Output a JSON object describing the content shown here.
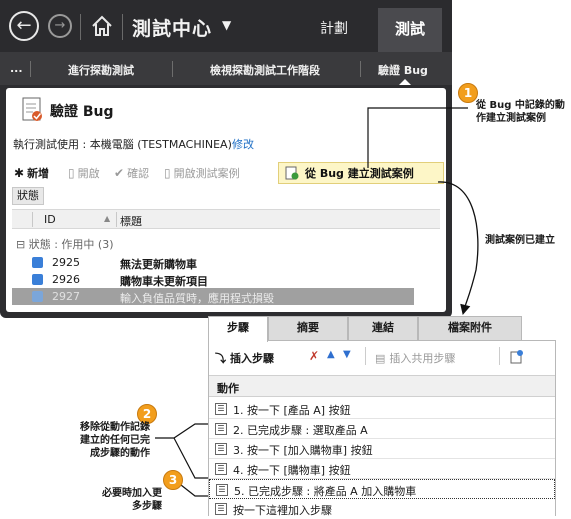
{
  "top_nav": {
    "hub_title": "測試中心",
    "dropdown_glyph": "▼",
    "tab_plan": "計劃",
    "tab_test": "測試",
    "back_icon": "←",
    "forward_icon": "→"
  },
  "sub_nav": {
    "ellipsis": "...",
    "items": [
      "進行探勘測試",
      "檢視探勘測試工作階段",
      "驗證 Bug"
    ]
  },
  "bug_panel": {
    "title": "驗證 Bug",
    "exec_label": "執行測試使用 : 本機電腦 (TESTMACHINEA)",
    "exec_edit": "修改",
    "toolbar": {
      "new": "新增",
      "open": "開啟",
      "confirm": "確認",
      "open_test_case": "開啟測試案例",
      "create_test_case": "從 Bug 建立測試案例"
    },
    "state_button": "狀態",
    "grid": {
      "col_id": "ID",
      "col_title": "標題",
      "group_label": "狀態 : 作用中 (3)",
      "rows": [
        {
          "id": "2925",
          "title": "無法更新購物車"
        },
        {
          "id": "2926",
          "title": "購物車未更新項目"
        },
        {
          "id": "2927",
          "title": "輸入負值品質時，應用程式損毀"
        }
      ]
    }
  },
  "callouts": {
    "c1_num": "1",
    "c1_text_line1": "從 Bug 中記錄的動",
    "c1_text_line2": "作建立測試案例",
    "created_label": "測試案例已建立",
    "c2_num": "2",
    "c2_line1": "移除從動作記錄",
    "c2_line2": "建立的任何已完",
    "c2_line3": "成步驟的動作",
    "c3_num": "3",
    "c3_line1": "必要時加入更",
    "c3_line2": "多步驟"
  },
  "steps_panel": {
    "tabs": [
      "步驟",
      "摘要",
      "連結",
      "檔案附件"
    ],
    "insert_step": "插入步驟",
    "insert_shared_steps": "插入共用步驟",
    "header_action": "動作",
    "steps": [
      "1. 按一下 [產品 A] 按鈕",
      "2. 已完成步驟 : 選取產品 A",
      "3. 按一下 [加入購物車] 按鈕",
      "4. 按一下 [購物車] 按鈕",
      "5. 已完成步驟 : 將產品 A 加入購物車"
    ],
    "add_step_hint": "按一下這裡加入步驟"
  }
}
